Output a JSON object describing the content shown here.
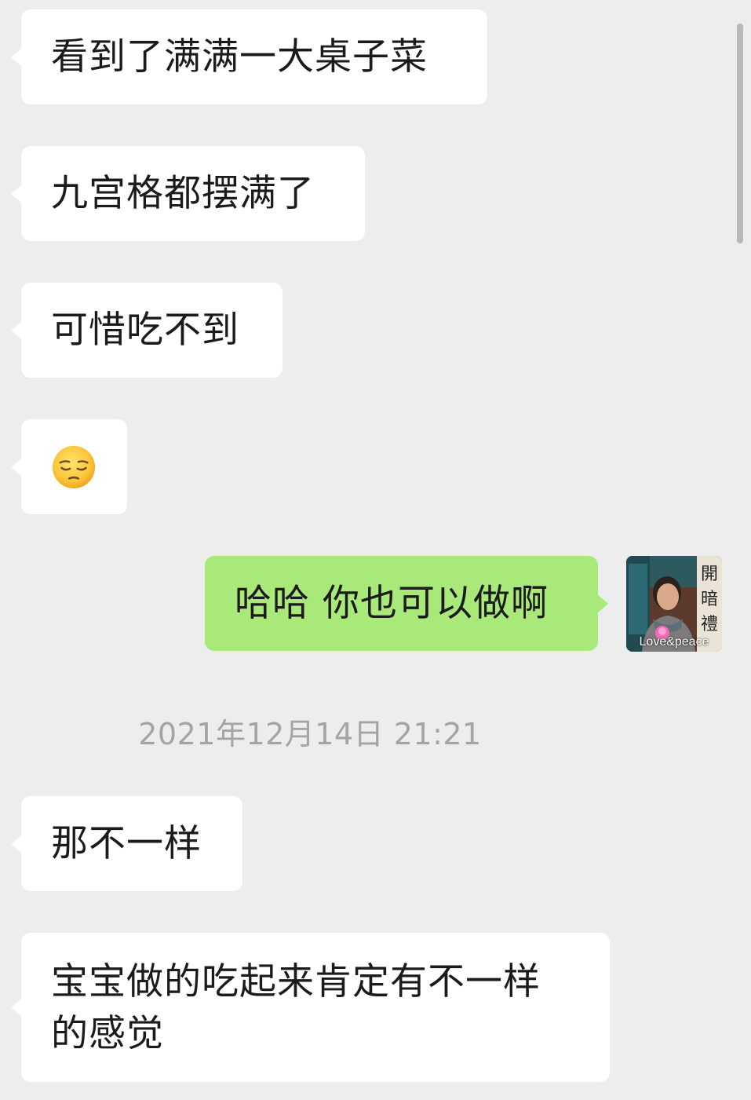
{
  "messages": [
    {
      "side": "left",
      "text": "看到了满满一大桌子菜"
    },
    {
      "side": "left",
      "text": "九宫格都摆满了"
    },
    {
      "side": "left",
      "text": "可惜吃不到"
    },
    {
      "side": "left",
      "emoji": "pensive-face-emoji"
    },
    {
      "side": "right",
      "text": "哈哈 你也可以做啊"
    },
    {
      "side": "left",
      "text": "那不一样"
    },
    {
      "side": "left",
      "text_line1": "宝宝做的吃起来肯定有不一样",
      "text_line2": "的感觉"
    }
  ],
  "timestamp": "2021年12月14日 21:21",
  "avatar": {
    "caption": "Love&peace",
    "sign_chars": "開 暗 禮"
  },
  "colors": {
    "background": "#ededed",
    "incoming_bubble": "#ffffff",
    "outgoing_bubble": "#a9e97a",
    "timestamp_text": "#a4a4a4"
  }
}
